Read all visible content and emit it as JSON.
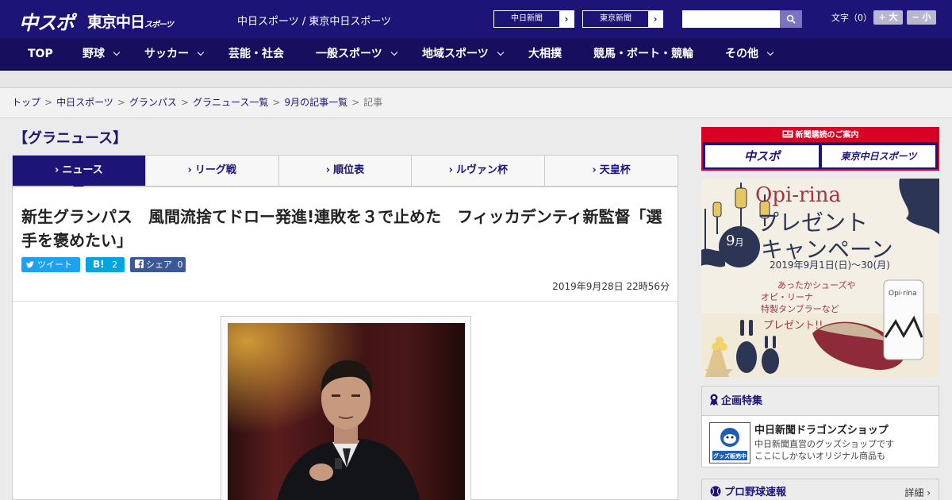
{
  "header": {
    "logo_primary": "中スポ",
    "logo_secondary": "東京中日",
    "logo_secondary_small": "スポーツ",
    "site_links": "中日スポーツ / 東京中日スポーツ",
    "paper_buttons": [
      "中日新聞",
      "東京新聞"
    ],
    "search_placeholder": "",
    "font_size_label": "文字（0）",
    "font_larger": "+ 大",
    "font_smaller": "− 小"
  },
  "nav": {
    "items": [
      {
        "label": "TOP"
      },
      {
        "label": "野球"
      },
      {
        "label": "サッカー"
      },
      {
        "label": "芸能・社会"
      },
      {
        "label": "一般スポーツ"
      },
      {
        "label": "地域スポーツ"
      },
      {
        "label": "大相撲"
      },
      {
        "label": "競馬・ボート・競輪"
      },
      {
        "label": "その他"
      }
    ]
  },
  "breadcrumb": {
    "items": [
      "トップ",
      "中日スポーツ",
      "グランパス",
      "グラニュース一覧",
      "9月の記事一覧"
    ],
    "current": "記事"
  },
  "category_title": "【グラニュース】",
  "tabs": [
    {
      "label": "ニュース"
    },
    {
      "label": "リーグ戦"
    },
    {
      "label": "順位表"
    },
    {
      "label": "ルヴァン杯"
    },
    {
      "label": "天皇杯"
    }
  ],
  "article": {
    "headline": "新生グランパス　風間流捨てドロー発進!連敗を３で止めた　フィッカデンティ新監督「選手を褒めたい」",
    "share": {
      "tweet": "ツイート",
      "hatena_mark": "B!",
      "hatena_count": "2",
      "facebook": "シェア",
      "facebook_count": "0"
    },
    "date": "2019年9月28日 22時56分"
  },
  "sidebar": {
    "subscription": {
      "header": "新聞購読のご案内",
      "buttons": [
        "中スポ",
        "東京中日スポーツ"
      ]
    },
    "ad": {
      "brand": "Opi-rina",
      "month_num": "9",
      "month_unit": "月",
      "line1": "プレゼント",
      "line2": "キャンペーン",
      "period": "2019年9月1日(日)〜30(月)",
      "copy1": "あったかシューズや",
      "copy2": "オピ・リーナ",
      "copy3": "特製タンブラーなど",
      "copy4": "プレゼント!!",
      "tumbler_text": "Opi·rina"
    },
    "feature": {
      "header": "企画特集",
      "icon_caption": "グッズ販売中",
      "title": "中日新聞ドラゴンズショップ",
      "desc1": "中日新聞直営のグッズショップです",
      "desc2": "ここにしかないオリジナル商品も"
    },
    "baseball": {
      "header": "プロ野球速報",
      "more": "詳細 ›"
    }
  },
  "colors": {
    "brand_navy": "#1c1477",
    "nav_dark": "#170f5e",
    "sub_red": "#d90025",
    "twitter": "#1da1f2",
    "hatena": "#00a4de",
    "facebook": "#3b5998"
  }
}
